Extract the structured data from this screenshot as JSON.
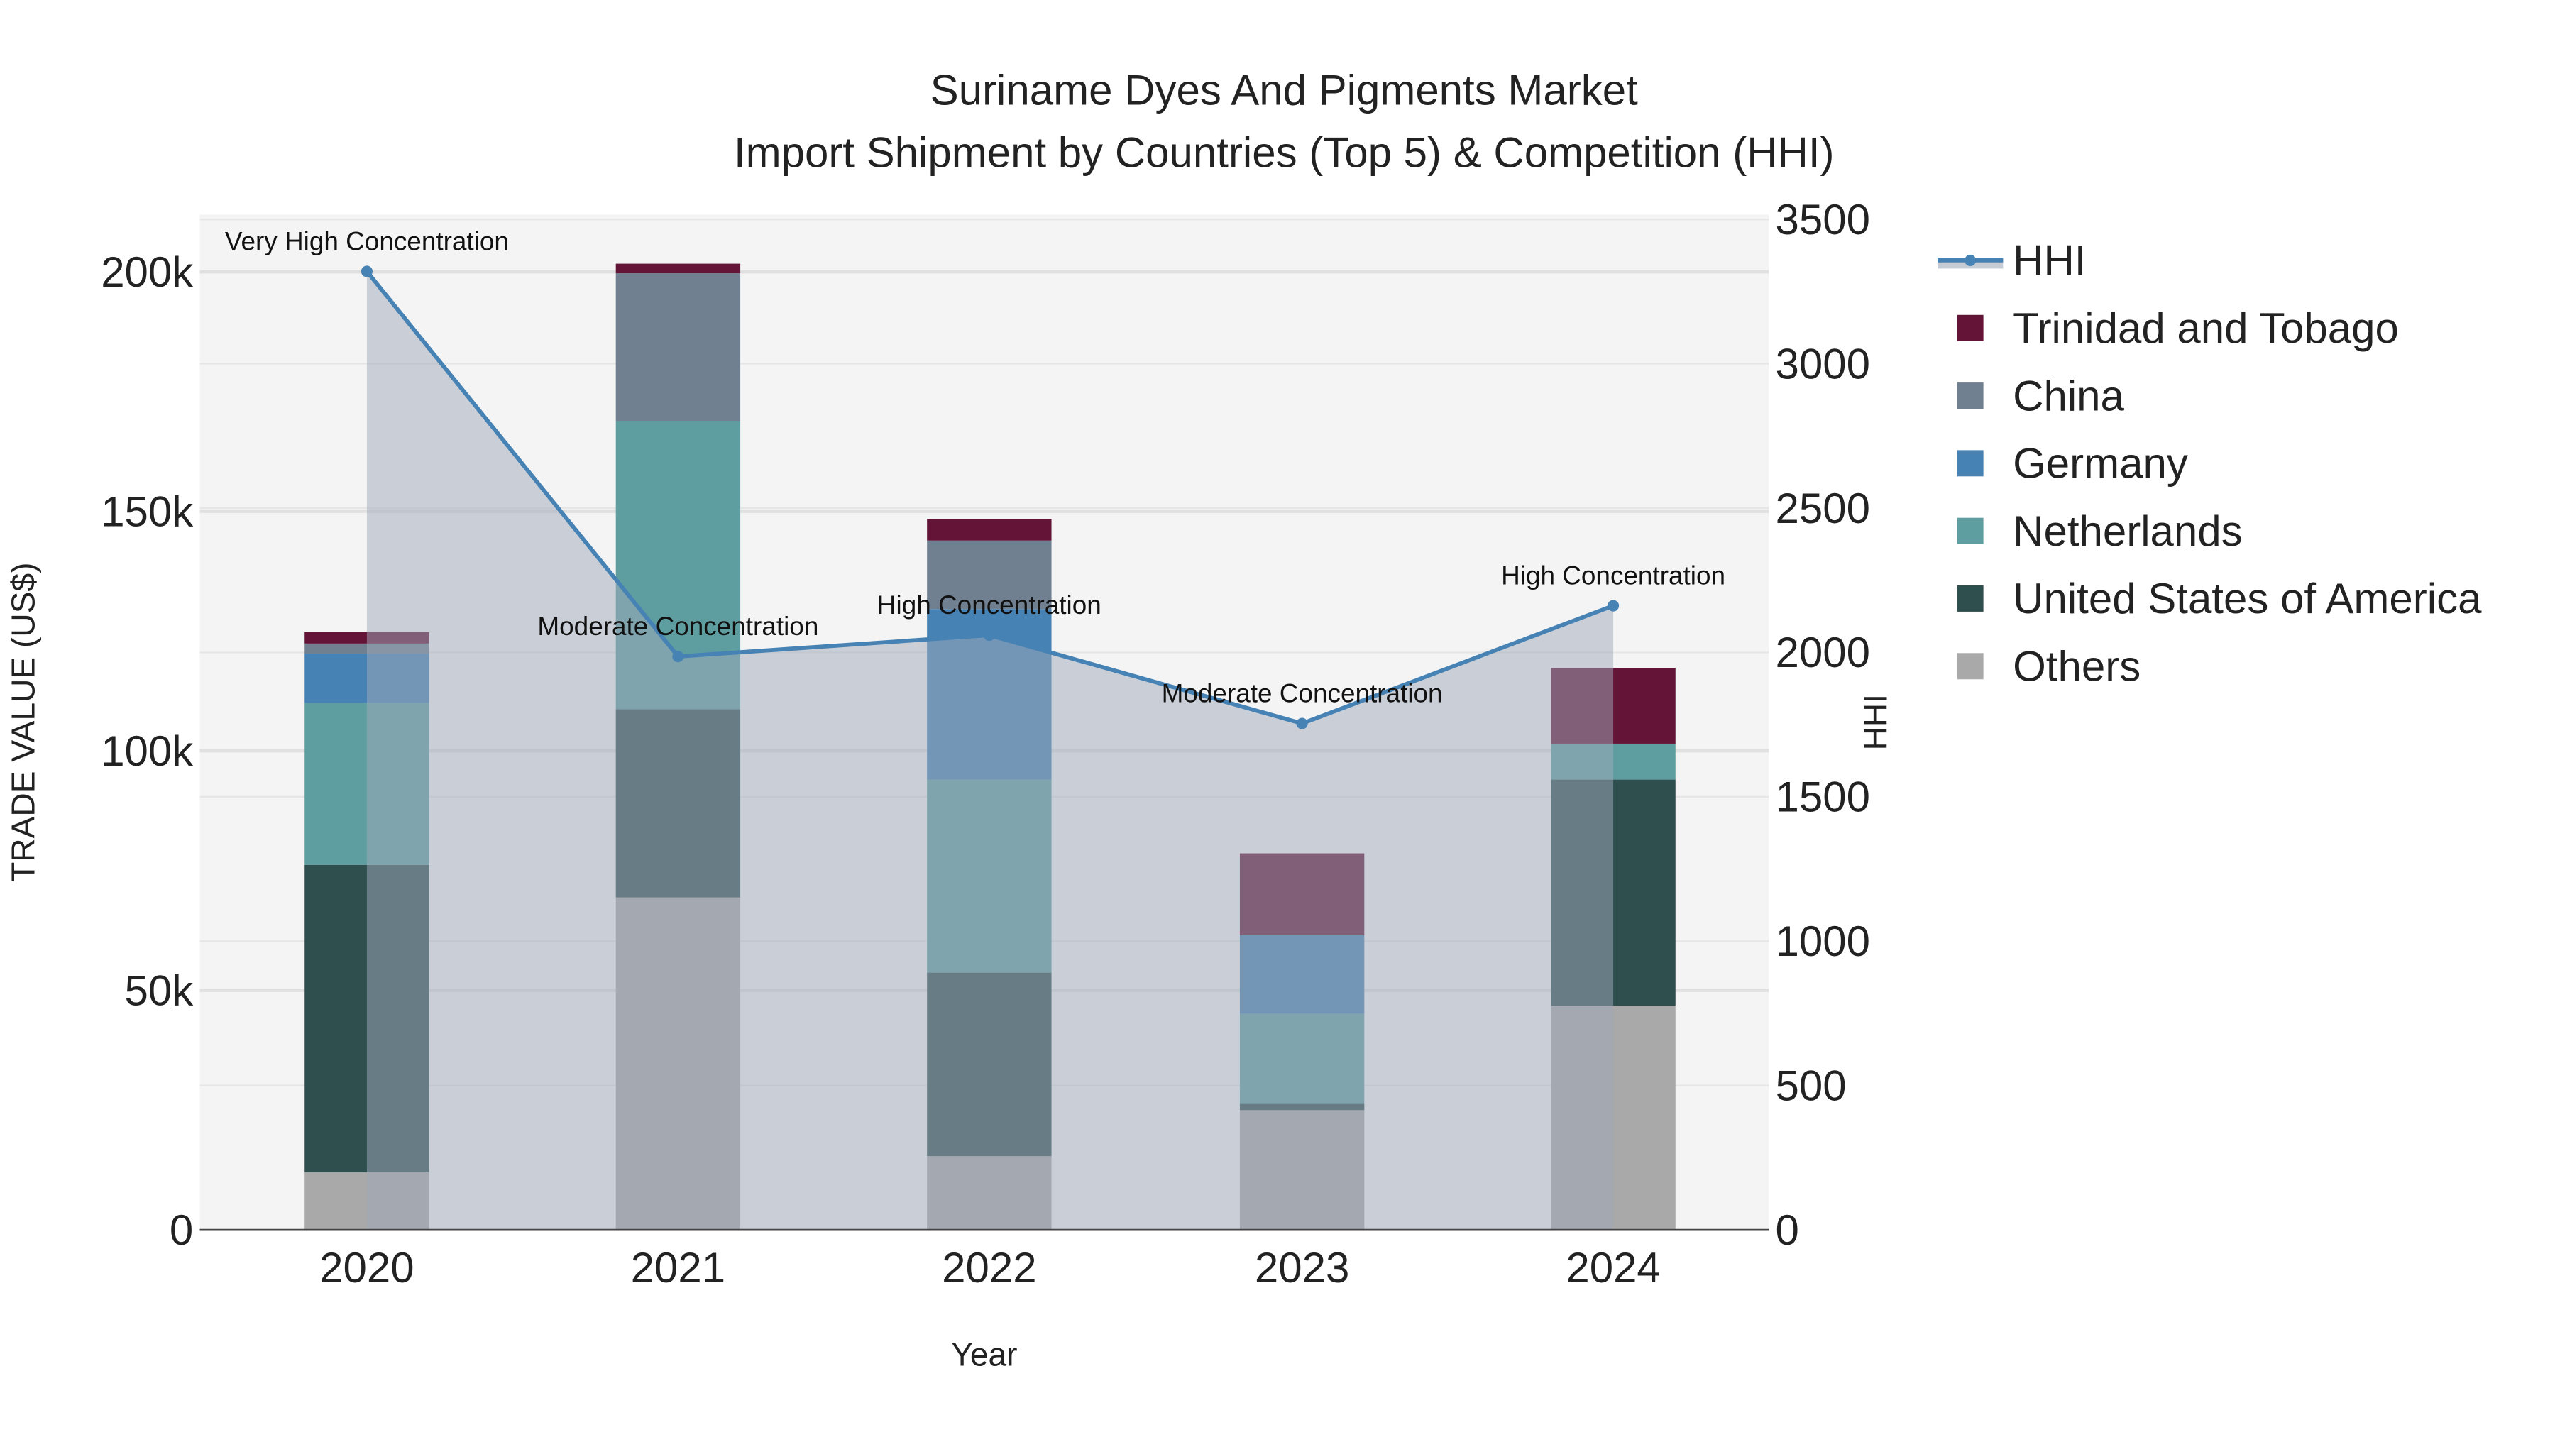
{
  "chart_data": {
    "type": "bar",
    "barmode": "stack",
    "title": "Suriname Dyes And Pigments Market",
    "subtitle": "Import Shipment by Countries (Top 5) & Competition (HHI)",
    "xlabel": "Year",
    "ylabel": "TRADE VALUE (US$)",
    "y2label": "HHI",
    "categories": [
      "2020",
      "2021",
      "2022",
      "2023",
      "2024"
    ],
    "ylim": [
      0,
      210000
    ],
    "y2lim": [
      0,
      3500
    ],
    "yticks": [
      0,
      50000,
      100000,
      150000,
      200000
    ],
    "ytick_labels": [
      "0",
      "50k",
      "100k",
      "150k",
      "200k"
    ],
    "y2ticks": [
      0,
      500,
      1000,
      1500,
      2000,
      2500,
      3000,
      3500
    ],
    "y2tick_labels": [
      "0",
      "500",
      "1000",
      "1500",
      "2000",
      "2500",
      "3000",
      "3500"
    ],
    "series": [
      {
        "name": "Others",
        "color": "#a9a9a9",
        "values": [
          12000,
          69400,
          15400,
          25000,
          46800
        ]
      },
      {
        "name": "United States of America",
        "color": "#2f4f4f",
        "values": [
          64200,
          39300,
          38300,
          1300,
          47200
        ]
      },
      {
        "name": "Netherlands",
        "color": "#5f9ea0",
        "values": [
          33800,
          60200,
          40300,
          18800,
          7500
        ]
      },
      {
        "name": "Germany",
        "color": "#4682b4",
        "values": [
          10300,
          0,
          35600,
          16400,
          0
        ]
      },
      {
        "name": "China",
        "color": "#708090",
        "values": [
          2100,
          30800,
          14300,
          0,
          0
        ]
      },
      {
        "name": "Trinidad and Tobago",
        "color": "#641537",
        "values": [
          2400,
          2000,
          4500,
          17100,
          15800
        ]
      }
    ],
    "hhi": {
      "name": "HHI",
      "color": "#4682b4",
      "values": [
        3320,
        1986,
        2060,
        1754,
        2162
      ],
      "annotations": [
        "Very High Concentration",
        "Moderate Concentration",
        "High Concentration",
        "Moderate Concentration",
        "High Concentration"
      ]
    },
    "legend": {
      "placement": "right",
      "entries": [
        "HHI",
        "Trinidad and Tobago",
        "China",
        "Germany",
        "Netherlands",
        "United States of America",
        "Others"
      ]
    },
    "grid": true
  }
}
